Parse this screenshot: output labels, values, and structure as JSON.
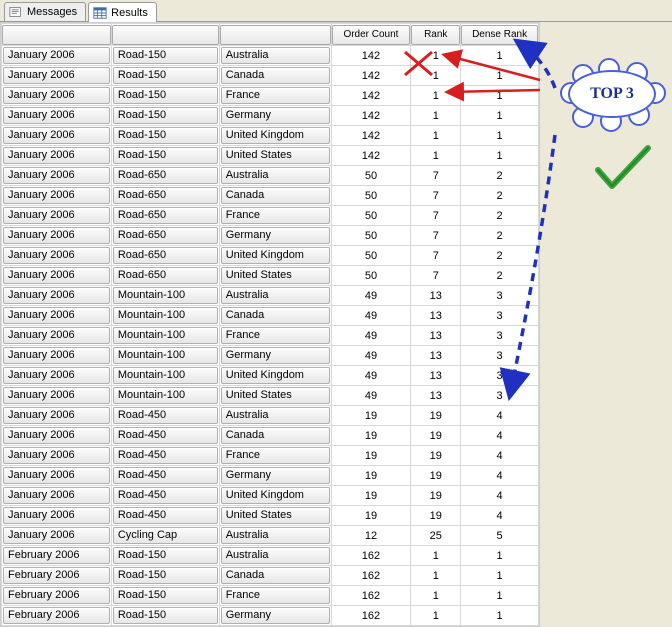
{
  "tabs": {
    "messages": "Messages",
    "results": "Results"
  },
  "headers": {
    "order_count": "Order Count",
    "rank": "Rank",
    "dense_rank": "Dense Rank"
  },
  "annotation": {
    "cloud": "TOP 3"
  },
  "rows": [
    {
      "month": "January 2006",
      "prod": "Road-150",
      "country": "Australia",
      "cnt": "142",
      "rank": "1",
      "dense": "1"
    },
    {
      "month": "January 2006",
      "prod": "Road-150",
      "country": "Canada",
      "cnt": "142",
      "rank": "1",
      "dense": "1"
    },
    {
      "month": "January 2006",
      "prod": "Road-150",
      "country": "France",
      "cnt": "142",
      "rank": "1",
      "dense": "1"
    },
    {
      "month": "January 2006",
      "prod": "Road-150",
      "country": "Germany",
      "cnt": "142",
      "rank": "1",
      "dense": "1"
    },
    {
      "month": "January 2006",
      "prod": "Road-150",
      "country": "United Kingdom",
      "cnt": "142",
      "rank": "1",
      "dense": "1"
    },
    {
      "month": "January 2006",
      "prod": "Road-150",
      "country": "United States",
      "cnt": "142",
      "rank": "1",
      "dense": "1"
    },
    {
      "month": "January 2006",
      "prod": "Road-650",
      "country": "Australia",
      "cnt": "50",
      "rank": "7",
      "dense": "2"
    },
    {
      "month": "January 2006",
      "prod": "Road-650",
      "country": "Canada",
      "cnt": "50",
      "rank": "7",
      "dense": "2"
    },
    {
      "month": "January 2006",
      "prod": "Road-650",
      "country": "France",
      "cnt": "50",
      "rank": "7",
      "dense": "2"
    },
    {
      "month": "January 2006",
      "prod": "Road-650",
      "country": "Germany",
      "cnt": "50",
      "rank": "7",
      "dense": "2"
    },
    {
      "month": "January 2006",
      "prod": "Road-650",
      "country": "United Kingdom",
      "cnt": "50",
      "rank": "7",
      "dense": "2"
    },
    {
      "month": "January 2006",
      "prod": "Road-650",
      "country": "United States",
      "cnt": "50",
      "rank": "7",
      "dense": "2"
    },
    {
      "month": "January 2006",
      "prod": "Mountain-100",
      "country": "Australia",
      "cnt": "49",
      "rank": "13",
      "dense": "3"
    },
    {
      "month": "January 2006",
      "prod": "Mountain-100",
      "country": "Canada",
      "cnt": "49",
      "rank": "13",
      "dense": "3"
    },
    {
      "month": "January 2006",
      "prod": "Mountain-100",
      "country": "France",
      "cnt": "49",
      "rank": "13",
      "dense": "3"
    },
    {
      "month": "January 2006",
      "prod": "Mountain-100",
      "country": "Germany",
      "cnt": "49",
      "rank": "13",
      "dense": "3"
    },
    {
      "month": "January 2006",
      "prod": "Mountain-100",
      "country": "United Kingdom",
      "cnt": "49",
      "rank": "13",
      "dense": "3"
    },
    {
      "month": "January 2006",
      "prod": "Mountain-100",
      "country": "United States",
      "cnt": "49",
      "rank": "13",
      "dense": "3"
    },
    {
      "month": "January 2006",
      "prod": "Road-450",
      "country": "Australia",
      "cnt": "19",
      "rank": "19",
      "dense": "4"
    },
    {
      "month": "January 2006",
      "prod": "Road-450",
      "country": "Canada",
      "cnt": "19",
      "rank": "19",
      "dense": "4"
    },
    {
      "month": "January 2006",
      "prod": "Road-450",
      "country": "France",
      "cnt": "19",
      "rank": "19",
      "dense": "4"
    },
    {
      "month": "January 2006",
      "prod": "Road-450",
      "country": "Germany",
      "cnt": "19",
      "rank": "19",
      "dense": "4"
    },
    {
      "month": "January 2006",
      "prod": "Road-450",
      "country": "United Kingdom",
      "cnt": "19",
      "rank": "19",
      "dense": "4"
    },
    {
      "month": "January 2006",
      "prod": "Road-450",
      "country": "United States",
      "cnt": "19",
      "rank": "19",
      "dense": "4"
    },
    {
      "month": "January 2006",
      "prod": "Cycling Cap",
      "country": "Australia",
      "cnt": "12",
      "rank": "25",
      "dense": "5"
    },
    {
      "month": "February 2006",
      "prod": "Road-150",
      "country": "Australia",
      "cnt": "162",
      "rank": "1",
      "dense": "1"
    },
    {
      "month": "February 2006",
      "prod": "Road-150",
      "country": "Canada",
      "cnt": "162",
      "rank": "1",
      "dense": "1"
    },
    {
      "month": "February 2006",
      "prod": "Road-150",
      "country": "France",
      "cnt": "162",
      "rank": "1",
      "dense": "1"
    },
    {
      "month": "February 2006",
      "prod": "Road-150",
      "country": "Germany",
      "cnt": "162",
      "rank": "1",
      "dense": "1"
    }
  ]
}
